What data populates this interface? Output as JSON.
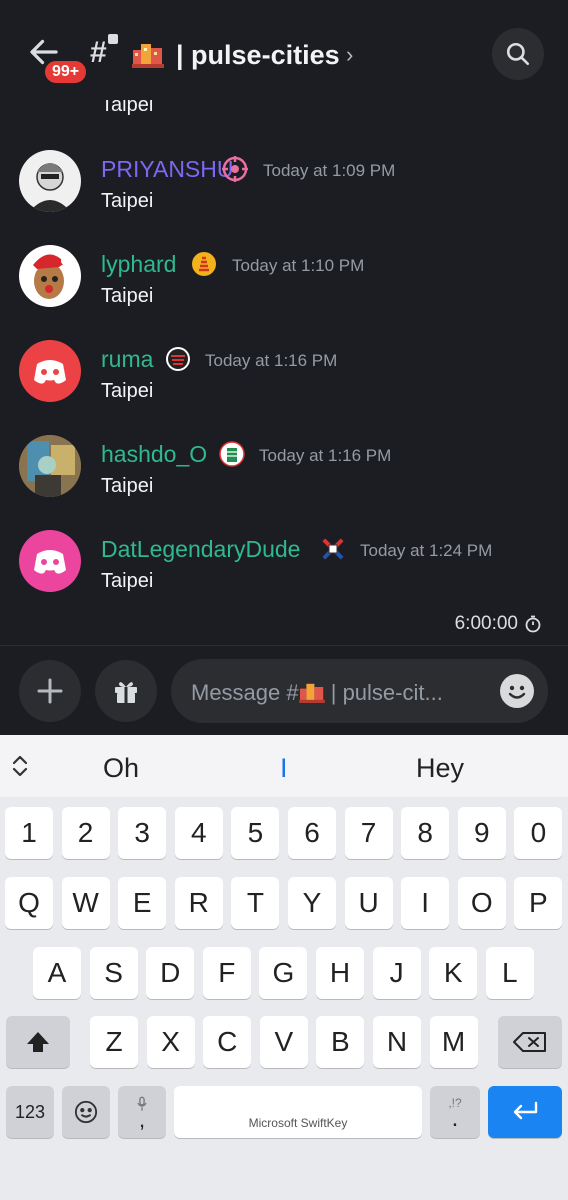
{
  "header": {
    "unread_badge": "99+",
    "channel_name": "| pulse-cities",
    "chevron": "›"
  },
  "messages": [
    {
      "text": "Taipei"
    },
    {
      "author": "PRIYANSHU",
      "author_color": "#7c68f4",
      "time": "Today at 1:09 PM",
      "text": "Taipei"
    },
    {
      "author": "lyphard",
      "author_color": "#2fb98f",
      "time": "Today at 1:10 PM",
      "text": "Taipei"
    },
    {
      "author": "ruma",
      "author_color": "#2fb98f",
      "time": "Today at 1:16 PM",
      "text": "Taipei"
    },
    {
      "author": "hashdo_O",
      "author_color": "#2fb98f",
      "time": "Today at 1:16 PM",
      "text": "Taipei"
    },
    {
      "author": "DatLegendaryDude",
      "author_color": "#2fb98f",
      "time": "Today at 1:24 PM",
      "text": "Taipei"
    }
  ],
  "slowmode_timer": "6:00:00",
  "composer": {
    "placeholder_prefix": "Message #",
    "placeholder_suffix": " | pulse-cit..."
  },
  "keyboard": {
    "suggestions": [
      "Oh",
      "I",
      "Hey"
    ],
    "row_numbers": [
      "1",
      "2",
      "3",
      "4",
      "5",
      "6",
      "7",
      "8",
      "9",
      "0"
    ],
    "row_q": [
      "Q",
      "W",
      "E",
      "R",
      "T",
      "Y",
      "U",
      "I",
      "O",
      "P"
    ],
    "row_a": [
      "A",
      "S",
      "D",
      "F",
      "G",
      "H",
      "J",
      "K",
      "L"
    ],
    "row_z": [
      "Z",
      "X",
      "C",
      "V",
      "B",
      "N",
      "M"
    ],
    "numbers_key": "123",
    "comma_key": ",",
    "space_label": "Microsoft SwiftKey",
    "period_key": ".",
    "period_alt": ",!?"
  },
  "icons": [
    "back-arrow-icon",
    "hash-lock-icon",
    "city-emoji-icon",
    "search-icon",
    "plus-icon",
    "gift-icon",
    "emoji-icon",
    "timer-icon",
    "shift-icon",
    "backspace-icon",
    "enter-icon"
  ],
  "colors": {
    "background": "#1c1d22",
    "surface": "#2b2d31",
    "accent_green": "#2fb98f",
    "accent_purple": "#7c68f4",
    "badge_red": "#e53935",
    "keyboard_enter": "#1a84f2"
  }
}
